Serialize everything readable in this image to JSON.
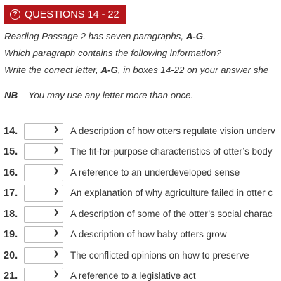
{
  "header": {
    "badge_icon": "question-circle-icon",
    "badge_label": "QUESTIONS 14 - 22",
    "badge_color": "#b5161b"
  },
  "instructions": {
    "line1_prefix": "Reading Passage 2 has seven paragraphs, ",
    "line1_bold": "A-G",
    "line1_suffix": ".",
    "line2": "Which paragraph contains the following information?",
    "line3_prefix": "Write the correct letter, ",
    "line3_bold": "A-G",
    "line3_suffix": ", in boxes 14-22 on your answer she"
  },
  "note": {
    "label": "NB",
    "text": "You may use any letter more than once."
  },
  "questions": [
    {
      "number": "14.",
      "selected": "",
      "text": "A description of how otters regulate vision underv"
    },
    {
      "number": "15.",
      "selected": "",
      "text": "The fit-for-purpose characteristics of otter’s body"
    },
    {
      "number": "16.",
      "selected": "",
      "text": "A reference to an underdeveloped sense"
    },
    {
      "number": "17.",
      "selected": "",
      "text": "An explanation of why agriculture failed in otter c"
    },
    {
      "number": "18.",
      "selected": "",
      "text": "A description of some of the otter’s social charac"
    },
    {
      "number": "19.",
      "selected": "",
      "text": "A description of how baby otters grow"
    },
    {
      "number": "20.",
      "selected": "",
      "text": "The conflicted opinions on how to preserve"
    },
    {
      "number": "21.",
      "selected": "",
      "text": "A reference to a legislative act"
    }
  ]
}
